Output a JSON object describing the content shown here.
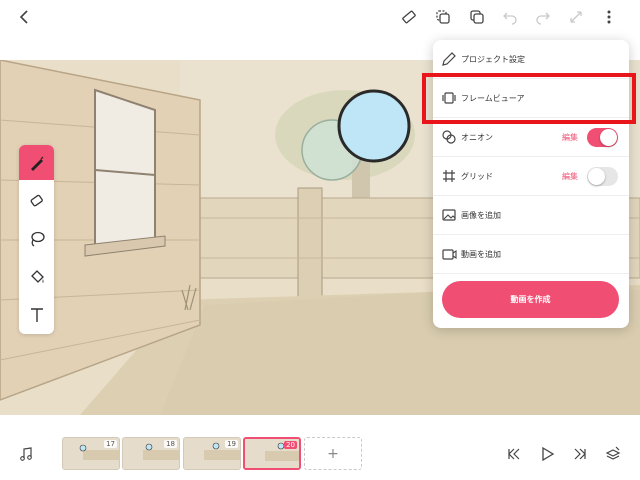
{
  "toolbar": {
    "back_icon": "chevron-left-icon",
    "right_icons": [
      "ruler-icon",
      "copy-frame-icon",
      "paste-frame-icon",
      "undo-icon",
      "redo-icon",
      "transform-icon",
      "more-vertical-icon"
    ]
  },
  "tools": [
    {
      "name": "pen",
      "icon": "pen-icon",
      "active": true
    },
    {
      "name": "eraser",
      "icon": "eraser-icon",
      "active": false
    },
    {
      "name": "lasso",
      "icon": "lasso-icon",
      "active": false
    },
    {
      "name": "fill",
      "icon": "fill-bucket-icon",
      "active": false
    },
    {
      "name": "text",
      "icon": "text-icon",
      "active": false
    }
  ],
  "menu": {
    "items": [
      {
        "label": "プロジェクト設定",
        "icon": "pencil-icon"
      },
      {
        "label": "フレームビューア",
        "icon": "frame-viewer-icon"
      },
      {
        "label": "オニオン",
        "icon": "onion-icon",
        "edit_label": "編集",
        "toggle_on": true
      },
      {
        "label": "グリッド",
        "icon": "grid-icon",
        "edit_label": "編集",
        "toggle_on": false
      },
      {
        "label": "画像を追加",
        "icon": "image-add-icon"
      },
      {
        "label": "動画を追加",
        "icon": "video-add-icon"
      }
    ],
    "create_button": "動画を作成"
  },
  "timeline": {
    "frames": [
      "17",
      "18",
      "19",
      "20"
    ],
    "current_frame": "20",
    "add_label": "+"
  },
  "colors": {
    "accent": "#f04e73",
    "highlight": "#e8161a"
  }
}
